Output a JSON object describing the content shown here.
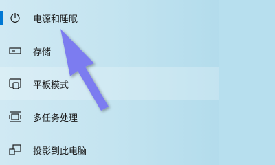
{
  "nav": {
    "items": [
      {
        "label": "电源和睡眠",
        "icon": "power-icon",
        "selected": true
      },
      {
        "label": "存储",
        "icon": "storage-icon",
        "selected": false
      },
      {
        "label": "平板模式",
        "icon": "tablet-mode-icon",
        "selected": false
      },
      {
        "label": "多任务处理",
        "icon": "multitasking-icon",
        "selected": false
      },
      {
        "label": "投影到此电脑",
        "icon": "project-to-pc-icon",
        "selected": false
      }
    ]
  },
  "colors": {
    "accent": "#0078d4",
    "arrow_fill": "#7b7cf0",
    "background": "#c4e4f0"
  }
}
